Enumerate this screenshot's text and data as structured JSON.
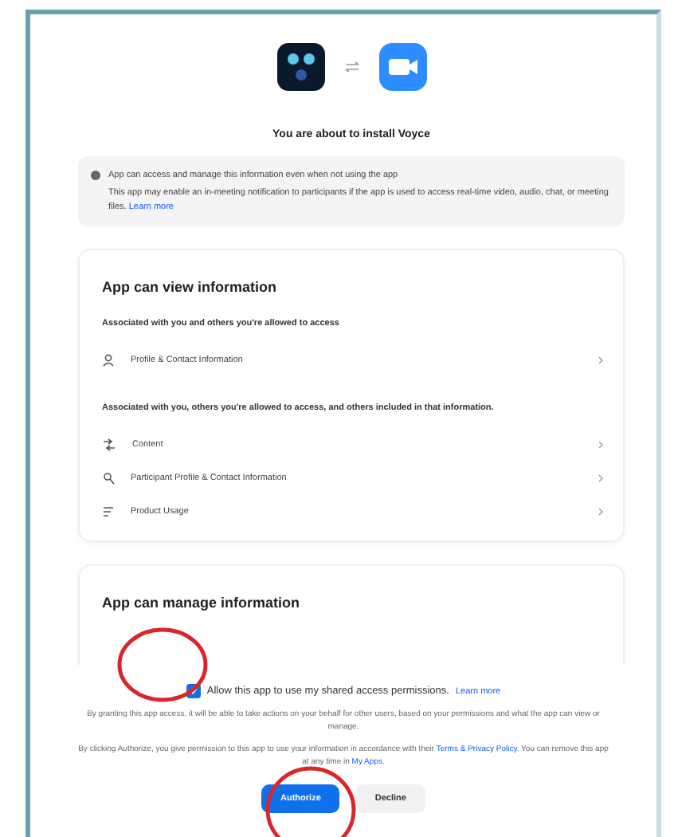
{
  "dialog": {
    "title": "You are about to install Voyce",
    "notice": {
      "heading": "App can access and manage this information even when not using the app",
      "body": "This app may enable an in-meeting notification to participants if the app is used to access real-time video, audio, chat, or meeting files.",
      "link": "Learn more"
    },
    "view_card": {
      "title": "App can view information",
      "groups": [
        {
          "heading": "Associated with you and others you're allowed to access",
          "items": [
            {
              "kind": "person",
              "label": "Profile & Contact Information"
            }
          ]
        },
        {
          "heading": "Associated with you, others you're allowed to access, and others included in that information.",
          "items": [
            {
              "kind": "content",
              "label": "Content"
            },
            {
              "kind": "search",
              "label": "Participant Profile & Contact Information"
            },
            {
              "kind": "list",
              "label": "Product Usage"
            }
          ]
        }
      ]
    },
    "manage_card": {
      "title": "App can manage information"
    },
    "footer": {
      "consent": {
        "label": "Allow this app to use my shared access permissions.",
        "link": "Learn more",
        "checked": true
      },
      "note": "By granting this app access, it will be able to take actions on your behalf for other users, based on your permissions and what the app can view or manage.",
      "terms": {
        "before": "By clicking Authorize, you give permission to this app to use your information in accordance with their",
        "link": "Terms & Privacy Policy",
        "middle": ". You can remove this app at any time in",
        "apps_link": "My Apps",
        "after": "."
      },
      "buttons": [
        {
          "kind": "primary",
          "label": "Authorize"
        },
        {
          "kind": "secondary",
          "label": "Decline"
        }
      ]
    }
  }
}
